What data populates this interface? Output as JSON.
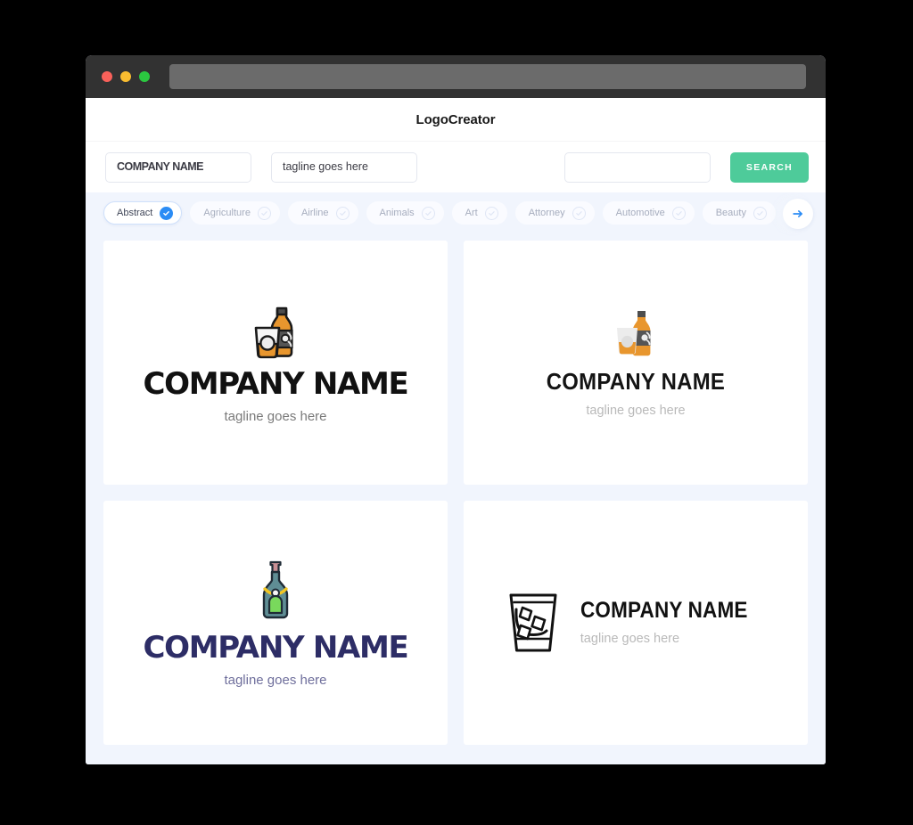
{
  "window": {
    "traffic_lights": [
      {
        "name": "close",
        "color": "#f9615a"
      },
      {
        "name": "minimize",
        "color": "#f9bc30"
      },
      {
        "name": "maximize",
        "color": "#2bc840"
      }
    ],
    "url_value": ""
  },
  "header": {
    "title": "LogoCreator"
  },
  "search": {
    "company_value": "COMPANY NAME",
    "company_placeholder": "COMPANY NAME",
    "tagline_value": "tagline goes here",
    "tagline_placeholder": "tagline goes here",
    "extra_value": "",
    "extra_placeholder": "",
    "button_label": "SEARCH",
    "button_color": "#4ecb9a"
  },
  "categories": {
    "accent_color": "#2b8cf5",
    "next_icon": "arrow-right-icon",
    "items": [
      {
        "label": "Abstract",
        "selected": true
      },
      {
        "label": "Agriculture",
        "selected": false
      },
      {
        "label": "Airline",
        "selected": false
      },
      {
        "label": "Animals",
        "selected": false
      },
      {
        "label": "Art",
        "selected": false
      },
      {
        "label": "Attorney",
        "selected": false
      },
      {
        "label": "Automotive",
        "selected": false
      },
      {
        "label": "Beauty",
        "selected": false
      }
    ]
  },
  "results": [
    {
      "icon": "whiskey-bottle-and-glass-icon",
      "company": "COMPANY NAME",
      "tagline": "tagline goes here",
      "company_color": "#111111",
      "tagline_color": "#7a7a7a",
      "layout": "stacked"
    },
    {
      "icon": "whiskey-bottle-and-glass-flat-icon",
      "company": "COMPANY NAME",
      "tagline": "tagline goes here",
      "company_color": "#141414",
      "tagline_color": "#b9b9b9",
      "layout": "stacked"
    },
    {
      "icon": "tequila-bottle-icon",
      "company": "COMPANY NAME",
      "tagline": "tagline goes here",
      "company_color": "#2d2d66",
      "tagline_color": "#6f6f9c",
      "layout": "stacked"
    },
    {
      "icon": "whiskey-glass-with-ice-outline-icon",
      "company": "COMPANY NAME",
      "tagline": "tagline goes here",
      "company_color": "#111111",
      "tagline_color": "#b9b9b9",
      "layout": "horizontal"
    }
  ]
}
